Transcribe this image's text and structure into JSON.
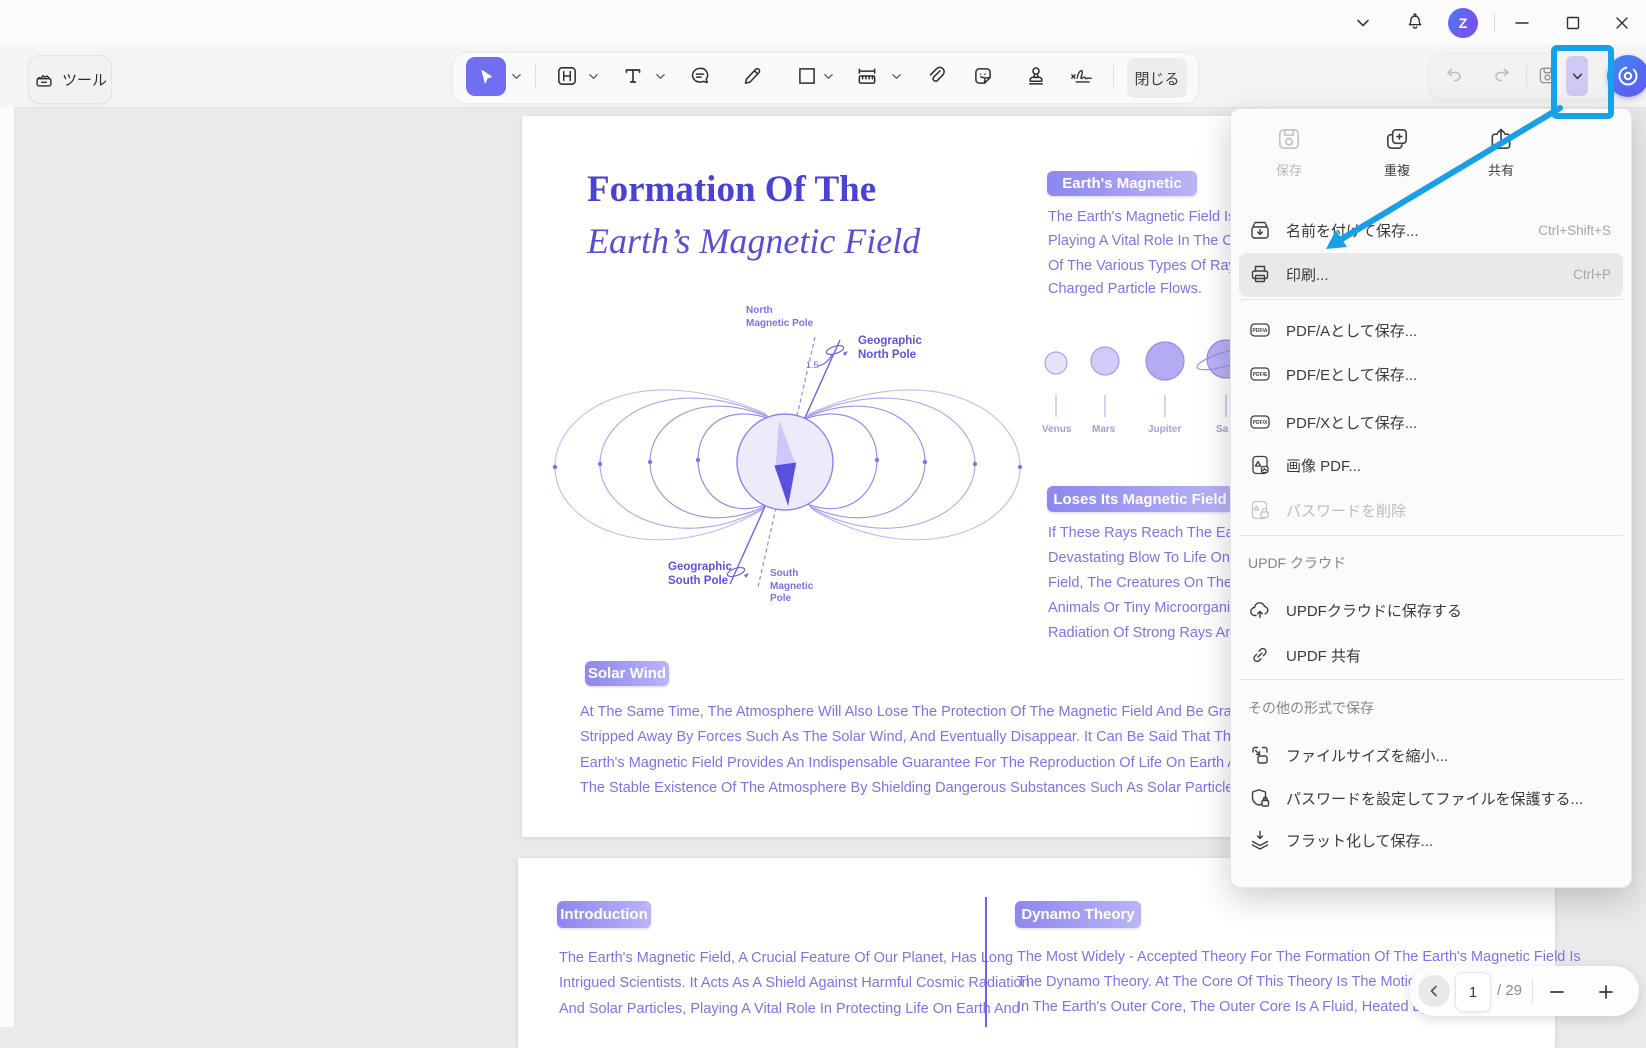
{
  "titlebar": {
    "avatar_initial": "Z"
  },
  "toolbar": {
    "tools_button_label": "ツール",
    "close_button_label": "閉じる"
  },
  "menu": {
    "quick_actions": [
      {
        "label": "保存",
        "disabled": true
      },
      {
        "label": "重複",
        "disabled": false
      },
      {
        "label": "共有",
        "disabled": false
      }
    ],
    "sections": {
      "cloud": "UPDF クラウド",
      "other": "その他の形式で保存"
    },
    "items": [
      {
        "label": "名前を付けて保存...",
        "shortcut": "Ctrl+Shift+S"
      },
      {
        "label": "印刷...",
        "shortcut": "Ctrl+P",
        "highlighted": true
      },
      {
        "label": "PDF/Aとして保存...",
        "badge": "PDF/A"
      },
      {
        "label": "PDF/Eとして保存...",
        "badge": "PDF/E"
      },
      {
        "label": "PDF/Xとして保存...",
        "badge": "PDF/X"
      },
      {
        "label": "画像 PDF..."
      },
      {
        "label": "パスワードを削除",
        "disabled": true
      },
      {
        "label": "UPDFクラウドに保存する"
      },
      {
        "label": "UPDF 共有"
      },
      {
        "label": "ファイルサイズを縮小..."
      },
      {
        "label": "パスワードを設定してファイルを保護する..."
      },
      {
        "label": "フラット化して保存..."
      }
    ]
  },
  "document": {
    "page1": {
      "title_line1": "Formation Of The",
      "title_line2": "Earth’s Magnetic Field",
      "diagram": {
        "north_magnetic_pole": "North\nMagnetic Pole",
        "geo_north_pole": "Geographic\nNorth Pole",
        "angle": "1.5",
        "geo_south_pole": "Geographic\nSouth Pole",
        "south_magnetic_pole": "South\nMagnetic\nPole"
      },
      "earths_magnetic": {
        "badge": "Earth's Magnetic",
        "lines": [
          "The Earth's Magnetic Field Is Like A",
          "Playing A Vital Role In The Cosmic",
          "Of The Various Types Of Rays In T",
          "Charged Particle Flows."
        ]
      },
      "planets": {
        "labels": [
          "Venus",
          "Mars",
          "Jupiter",
          "Sa"
        ]
      },
      "loses": {
        "badge": "Loses Its Magnetic Field",
        "lines": [
          "If These Rays Reach The Earth Wit",
          "Devastating Blow To Life On Earth.",
          "Field, The Creatures On The Earth'",
          "Animals Or Tiny Microorganisms, W",
          "Radiation Of Strong Rays And Will"
        ]
      },
      "solar_wind": {
        "badge": "Solar Wind",
        "lines": [
          "At The Same Time, The Atmosphere Will Also Lose The Protection Of The Magnetic Field And Be Gradually",
          "Stripped Away By Forces Such As The Solar Wind, And Eventually Disappear. It Can Be Said That The",
          "Earth's Magnetic Field Provides An Indispensable Guarantee For The Reproduction Of Life On Earth And",
          "The Stable Existence Of The Atmosphere By Shielding Dangerous Substances Such As Solar Particles."
        ]
      }
    },
    "page2": {
      "introduction": {
        "badge": "Introduction",
        "lines": [
          "The Earth's Magnetic Field, A Crucial Feature Of Our Planet, Has Long",
          "Intrigued Scientists. It Acts As A Shield Against Harmful Cosmic Radiation",
          "And Solar Particles, Playing A Vital Role In Protecting Life On Earth And"
        ]
      },
      "dynamo": {
        "badge": "Dynamo Theory",
        "lines": [
          "The Most Widely - Accepted Theory For The Formation Of The Earth's Magnetic Field Is",
          "The Dynamo Theory. At The Core Of This Theory Is The Motion Of Molten I",
          "In The Earth's Outer Core, The Outer Core Is A Fluid, Heated By The"
        ]
      }
    }
  },
  "page_nav": {
    "page": "1",
    "total": "/ 29"
  }
}
